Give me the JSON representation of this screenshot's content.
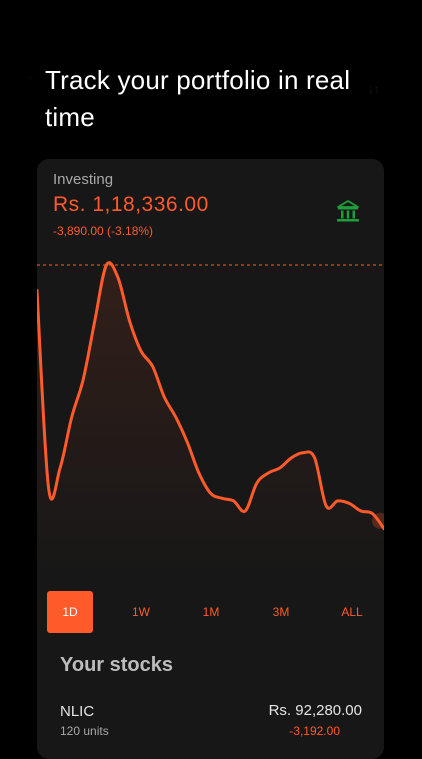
{
  "headline": "Track your portfolio in real time",
  "colors": {
    "background": "#000000",
    "card": "#171717",
    "accent": "#ff5a2a",
    "bank_icon": "#1e9e3a"
  },
  "portfolio": {
    "label": "Investing",
    "value": "Rs. 1,18,336.00",
    "change": "-3,890.00 (-3.18%)",
    "icon": "bank-icon"
  },
  "chart_data": {
    "type": "line",
    "series": [
      {
        "values": [
          90,
          12,
          20,
          40,
          55,
          78,
          100,
          95,
          78,
          66,
          60,
          48,
          40,
          30,
          18,
          10,
          8,
          7,
          3,
          14,
          18,
          20,
          24,
          26,
          24,
          5,
          7,
          6,
          3,
          2,
          -4
        ]
      }
    ],
    "reference_line": "previous close",
    "ylim": [
      -10,
      100
    ],
    "grid": false
  },
  "ranges": {
    "selected": "1D",
    "items": [
      "1D",
      "1W",
      "1M",
      "3M",
      "ALL"
    ]
  },
  "stocks": {
    "title": "Your stocks",
    "items": [
      {
        "symbol": "NLIC",
        "units": "120 units",
        "value": "Rs. 92,280.00",
        "change": "-3,192.00"
      }
    ]
  }
}
